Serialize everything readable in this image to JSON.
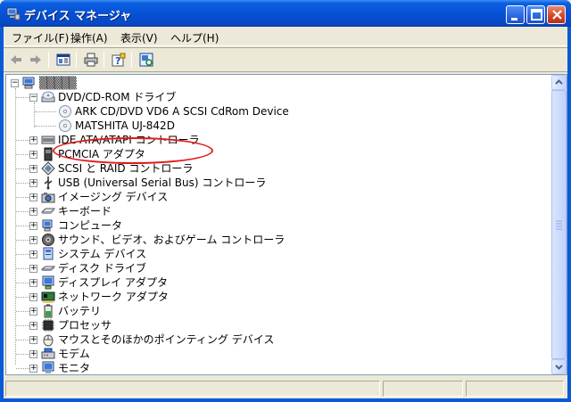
{
  "window": {
    "title": "デバイス マネージャ"
  },
  "menu": {
    "items": [
      "ファイル(F)",
      "操作(A)",
      "表示(V)",
      "ヘルプ(H)"
    ]
  },
  "toolbar": {
    "icons": [
      "back-arrow-icon",
      "forward-arrow-icon",
      "properties-view-icon",
      "print-icon",
      "help-icon",
      "scan-hardware-icon"
    ]
  },
  "tree": {
    "root": "▒▒▒▒▒",
    "dvd": {
      "label": "DVD/CD-ROM ドライブ",
      "children": [
        "ARK CD/DVD VD6 A SCSI CdRom Device",
        "MATSHITA UJ-842D"
      ]
    },
    "categories": [
      "IDE ATA/ATAPI コントローラ",
      "PCMCIA アダプタ",
      "SCSI と RAID コントローラ",
      "USB (Universal Serial Bus) コントローラ",
      "イメージング デバイス",
      "キーボード",
      "コンピュータ",
      "サウンド、ビデオ、およびゲーム コントローラ",
      "システム デバイス",
      "ディスク ドライブ",
      "ディスプレイ アダプタ",
      "ネットワーク アダプタ",
      "バッテリ",
      "プロセッサ",
      "マウスとそのほかのポインティング デバイス",
      "モデム",
      "モニタ"
    ]
  },
  "colors": {
    "titlebar": "#0651d6",
    "annotation": "#e01a1a",
    "chrome": "#ece9d8"
  }
}
